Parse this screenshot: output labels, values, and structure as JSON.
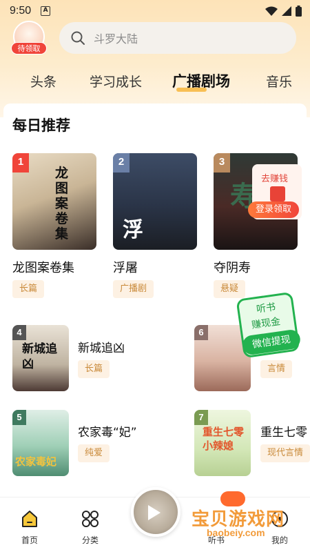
{
  "status_bar": {
    "time": "9:50",
    "indicator": "A"
  },
  "header": {
    "avatar_badge": "待领取",
    "search_placeholder": "斗罗大陆"
  },
  "tabs": [
    {
      "label": "头条"
    },
    {
      "label": "学习成长"
    },
    {
      "label": "广播剧场",
      "active": true
    },
    {
      "label": "音乐"
    }
  ],
  "section": {
    "title": "每日推荐"
  },
  "top_books": [
    {
      "rank": "1",
      "title": "龙图案卷集",
      "tag": "长篇",
      "rank_color": "#f0453a"
    },
    {
      "rank": "2",
      "title": "浮屠",
      "tag": "广播剧",
      "rank_color": "#6a7fa6"
    },
    {
      "rank": "3",
      "title": "夺阴寿",
      "tag": "悬疑",
      "rank_color": "#b98a5e"
    }
  ],
  "list_books": [
    {
      "rank": "4",
      "title": "新城追凶",
      "tag": "长篇"
    },
    {
      "rank": "5",
      "title": "农家毒“妃”",
      "tag": "纯爱"
    },
    {
      "rank": "6",
      "title": "",
      "tag": "言情"
    },
    {
      "rank": "7",
      "title": "重生七零",
      "tag": "现代言情"
    }
  ],
  "covers": {
    "c1": "龙图案卷集",
    "c2": "浮屠",
    "c3": "寿",
    "c4": "新城追凶",
    "c5": "农家毒妃",
    "c7": "重生七零小辣媳"
  },
  "promo_top": {
    "text": "去赚钱",
    "button": "登录领取"
  },
  "promo_green": {
    "line1": "听书",
    "line2": "赚现金",
    "button": "微信提现"
  },
  "bottom_nav": {
    "home": "首页",
    "category": "分类",
    "listen": "听书",
    "mine": "我的"
  },
  "watermark": {
    "text": "宝贝游戏网",
    "url": "baobeiy.com"
  },
  "colors": {
    "accent": "#f7b63c",
    "tag_bg": "#fdf1e3",
    "tag_text": "#c98a3a"
  }
}
